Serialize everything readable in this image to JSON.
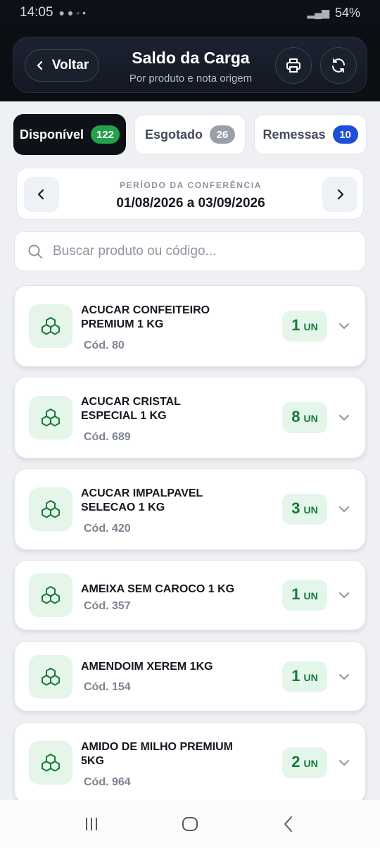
{
  "status": {
    "time": "14:05",
    "battery": "54%"
  },
  "header": {
    "back_label": "Voltar",
    "title": "Saldo da Carga",
    "subtitle": "Por produto e nota origem"
  },
  "tabs": [
    {
      "label": "Disponível",
      "count": "122"
    },
    {
      "label": "Esgotado",
      "count": "26"
    },
    {
      "label": "Remessas",
      "count": "10"
    }
  ],
  "period": {
    "label": "PERÍODO DA CONFERÊNCIA",
    "value": "01/08/2026 a 03/09/2026"
  },
  "search": {
    "placeholder": "Buscar produto ou código..."
  },
  "products": [
    {
      "name": "ACUCAR CONFEITEIRO PREMIUM 1 KG",
      "code": "Cód. 80",
      "qty": "1",
      "unit": "UN"
    },
    {
      "name": "ACUCAR CRISTAL ESPECIAL 1 KG",
      "code": "Cód. 689",
      "qty": "8",
      "unit": "UN"
    },
    {
      "name": "ACUCAR IMPALPAVEL SELECAO 1 KG",
      "code": "Cód. 420",
      "qty": "3",
      "unit": "UN"
    },
    {
      "name": "AMEIXA SEM CAROCO 1 KG",
      "code": "Cód. 357",
      "qty": "1",
      "unit": "UN"
    },
    {
      "name": "AMENDOIM XEREM 1KG",
      "code": "Cód. 154",
      "qty": "1",
      "unit": "UN"
    },
    {
      "name": "AMIDO DE MILHO PREMIUM 5KG",
      "code": "Cód. 964",
      "qty": "2",
      "unit": "UN"
    }
  ],
  "colors": {
    "accent_green": "#157a39",
    "active_tab_bg": "#0e1117",
    "badge_green": "#22a24a",
    "badge_blue": "#1d4fd8"
  }
}
